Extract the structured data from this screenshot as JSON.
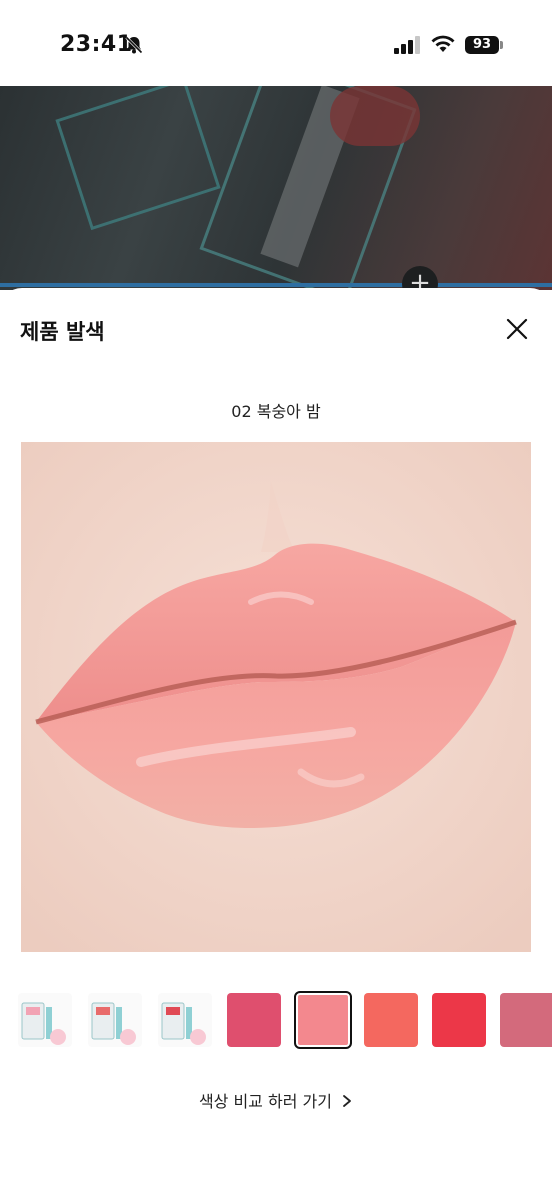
{
  "status_bar": {
    "time": "23:41",
    "battery": "93",
    "icons": [
      "bell-slash-icon",
      "signal-icon",
      "wifi-icon",
      "battery-icon"
    ]
  },
  "sheet": {
    "title": "제품 발색",
    "close_icon": "close-icon",
    "shade_name": "02 복숭아 밤",
    "swatches": [
      {
        "kind": "product",
        "tint": "#f2a3b4"
      },
      {
        "kind": "product",
        "tint": "#e86b6b"
      },
      {
        "kind": "product",
        "tint": "#e04a55"
      },
      {
        "kind": "color",
        "color": "#df4f6e"
      },
      {
        "kind": "color",
        "color": "#f3888e",
        "selected": true
      },
      {
        "kind": "color",
        "color": "#f4685f"
      },
      {
        "kind": "color",
        "color": "#ec3748"
      },
      {
        "kind": "color",
        "color": "#d36a7c"
      }
    ],
    "compare_link": "색상 비교 하러 가기"
  }
}
